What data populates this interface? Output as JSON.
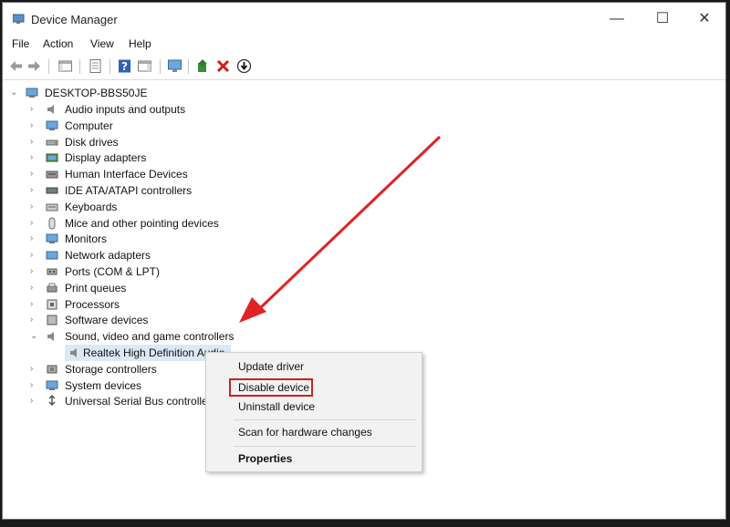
{
  "window": {
    "title": "Device Manager",
    "minimize": "—",
    "maximize": "☐",
    "close": "✕"
  },
  "menu": [
    "File",
    "Action",
    "View",
    "Help"
  ],
  "tree": {
    "root": "DESKTOP-BBS50JE",
    "items": [
      {
        "label": "Audio inputs and outputs",
        "icon": "speaker-icon"
      },
      {
        "label": "Computer",
        "icon": "monitor-icon"
      },
      {
        "label": "Disk drives",
        "icon": "disk-icon"
      },
      {
        "label": "Display adapters",
        "icon": "display-adapter-icon"
      },
      {
        "label": "Human Interface Devices",
        "icon": "hid-icon"
      },
      {
        "label": "IDE ATA/ATAPI controllers",
        "icon": "ide-icon"
      },
      {
        "label": "Keyboards",
        "icon": "keyboard-icon"
      },
      {
        "label": "Mice and other pointing devices",
        "icon": "mouse-icon"
      },
      {
        "label": "Monitors",
        "icon": "monitor-icon"
      },
      {
        "label": "Network adapters",
        "icon": "network-icon"
      },
      {
        "label": "Ports (COM & LPT)",
        "icon": "port-icon"
      },
      {
        "label": "Print queues",
        "icon": "printer-icon"
      },
      {
        "label": "Processors",
        "icon": "processor-icon"
      },
      {
        "label": "Software devices",
        "icon": "software-icon"
      },
      {
        "label": "Sound, video and game controllers",
        "icon": "speaker-icon",
        "expanded": true
      },
      {
        "label": "Realtek High Definition Audio",
        "icon": "speaker-icon",
        "child": true,
        "selected": true
      },
      {
        "label": "Storage controllers",
        "icon": "storage-icon"
      },
      {
        "label": "System devices",
        "icon": "system-icon"
      },
      {
        "label": "Universal Serial Bus controlle",
        "icon": "usb-icon"
      }
    ]
  },
  "context_menu": {
    "update_driver": "Update driver",
    "disable_device": "Disable device",
    "uninstall_device": "Uninstall device",
    "scan": "Scan for hardware changes",
    "properties": "Properties"
  },
  "colors": {
    "annotation_red": "#d02020",
    "selection": "#dbe9f7"
  }
}
